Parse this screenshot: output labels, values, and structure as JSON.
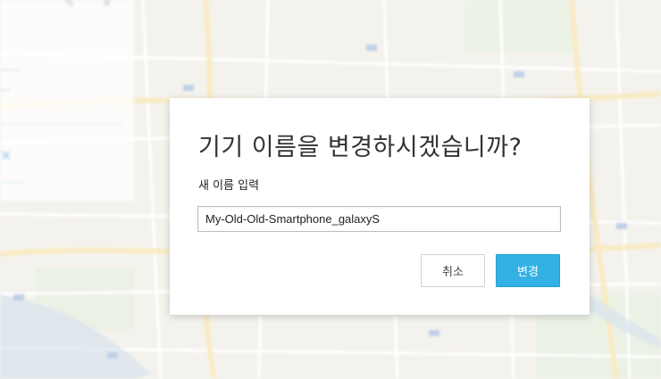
{
  "dialog": {
    "title": "기기 이름을 변경하시겠습니까?",
    "field_label": "새 이름 입력",
    "name_input_value": "My-Old-Old-Smartphone_galaxyS",
    "cancel_label": "취소",
    "confirm_label": "변경"
  },
  "colors": {
    "accent": "#33b1e4",
    "map_base": "#ece8df",
    "road_major": "#f5d98c"
  }
}
